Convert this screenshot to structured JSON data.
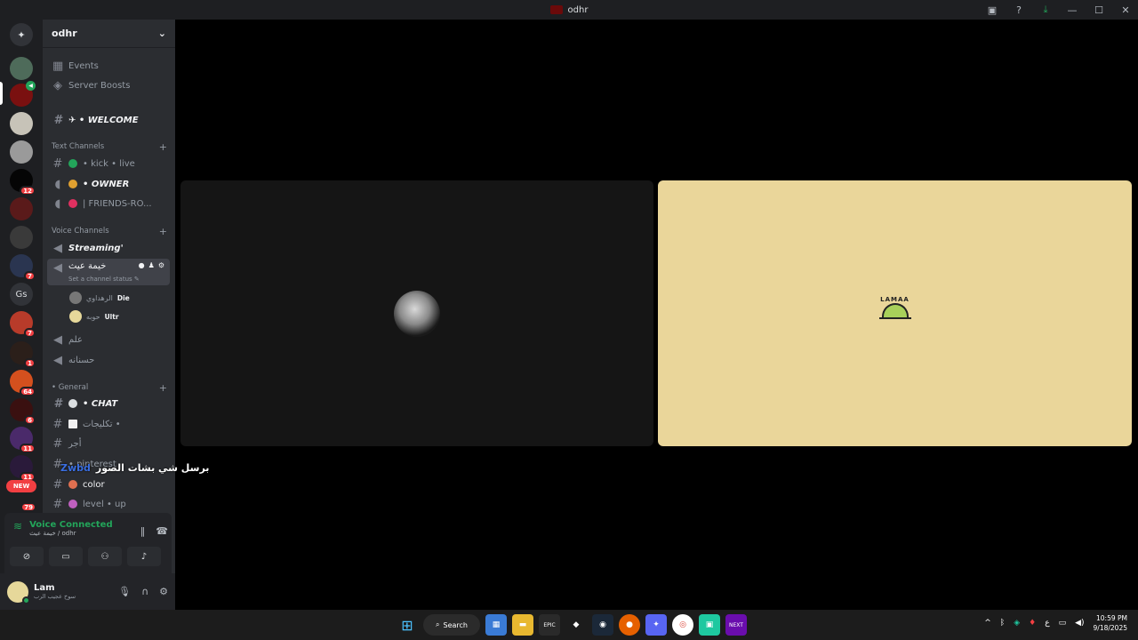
{
  "window": {
    "title": "odhr"
  },
  "server": {
    "name": "odhr"
  },
  "guild_badges": [
    "12",
    "7",
    "7",
    "1",
    "64",
    "6",
    "11",
    "11",
    "79"
  ],
  "guild_labels": {
    "gs": "Gs",
    "new": "NEW"
  },
  "sidebar": {
    "events": "Events",
    "boosts": "Server Boosts",
    "welcome": "✈ • WELCOME",
    "text_category": "Text Channels",
    "text_channels": [
      "• kick • live",
      "• OWNER",
      "| FRIENDS-RO..."
    ],
    "voice_category": "Voice Channels",
    "voice_channels": [
      "Streaming'",
      "خيمة عيث"
    ],
    "channel_status": "Set a channel status",
    "voice_users": [
      {
        "name": "الرهداوي",
        "tag": "Die"
      },
      {
        "name": "حوبه",
        "tag": "Ultr"
      }
    ],
    "more_voice": [
      "علم",
      "حسنانه"
    ],
    "general_category": "• General",
    "general_channels": [
      "• CHAT",
      "تكليجات •",
      "أجر",
      "• pinterest",
      "color",
      "level • up"
    ]
  },
  "voice_panel": {
    "label": "Voice Connected",
    "sub": "خيمة عيث / odhr"
  },
  "user": {
    "name": "Lam",
    "status": "سوخ عجيب الرب"
  },
  "overlay": {
    "user": "Zwbd",
    "message": "برسل شي بشات الصور"
  },
  "logo_text": "LAMAA",
  "taskbar": {
    "search": "Search",
    "lang": "ع",
    "time": "10:59 PM",
    "date": "9/18/2025"
  },
  "colors": {
    "accent_green": "#23a55a",
    "badge_red": "#f23f42",
    "sidebar": "#2b2d31",
    "tile_cream": "#ead69a"
  }
}
